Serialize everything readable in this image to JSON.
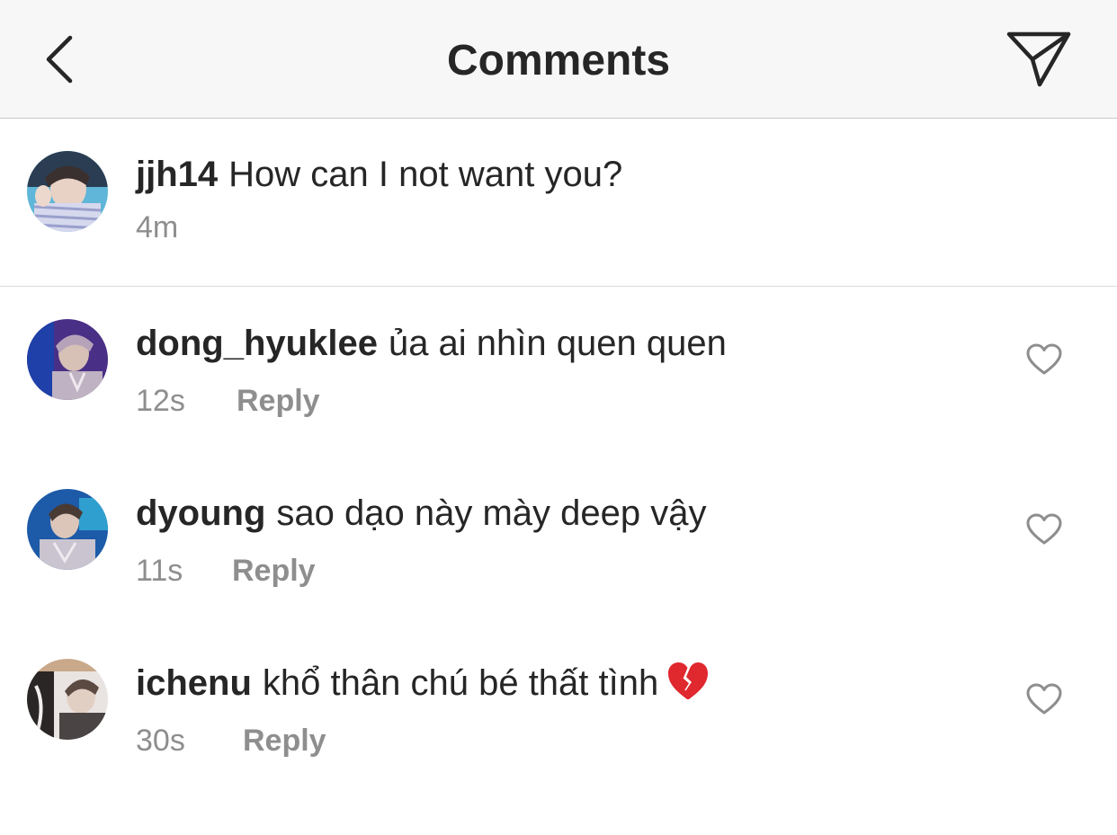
{
  "header": {
    "title": "Comments",
    "back_icon": "chevron-left-icon",
    "send_icon": "paper-plane-icon"
  },
  "caption": {
    "username": "jjh14",
    "text": "How can I not want you?",
    "time": "4m"
  },
  "comments": [
    {
      "username": "dong_hyuklee",
      "text": "ủa ai nhìn quen quen",
      "time": "12s",
      "reply_label": "Reply"
    },
    {
      "username": "dyoung",
      "text": "sao dạo này mày deep vậy",
      "time": "11s",
      "reply_label": "Reply"
    },
    {
      "username": "ichenu",
      "text": "khổ thân chú bé thất tình",
      "emoji": "broken-heart-icon",
      "time": "30s",
      "reply_label": "Reply"
    }
  ],
  "colors": {
    "text_primary": "#262626",
    "text_secondary": "#8e8e8e",
    "header_bg": "#f7f7f7",
    "divider": "#dbdbdb",
    "broken_heart": "#e0282f"
  }
}
